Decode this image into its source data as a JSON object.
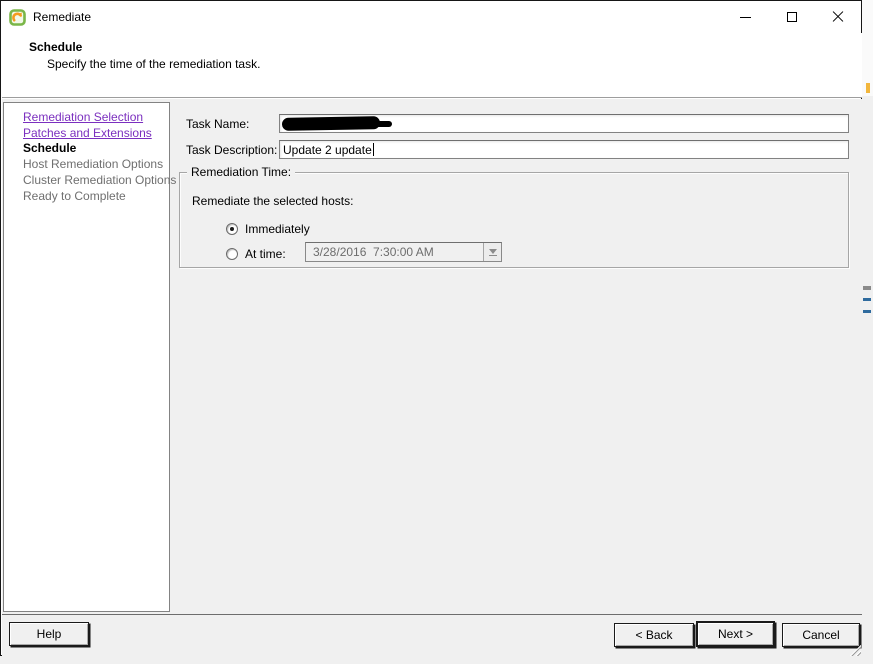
{
  "window": {
    "title": "Remediate",
    "controls": [
      "minimize",
      "maximize",
      "close"
    ]
  },
  "header": {
    "title": "Schedule",
    "subtitle": "Specify the time of the remediation task."
  },
  "sidebar": {
    "items": [
      {
        "label": "Remediation Selection",
        "state": "visited-link"
      },
      {
        "label": "Patches and Extensions",
        "state": "visited-link"
      },
      {
        "label": "Schedule",
        "state": "current"
      },
      {
        "label": "Host Remediation Options",
        "state": "upcoming"
      },
      {
        "label": "Cluster Remediation Options",
        "state": "upcoming"
      },
      {
        "label": "Ready to Complete",
        "state": "upcoming"
      }
    ]
  },
  "form": {
    "task_name": {
      "label": "Task Name:",
      "value": "",
      "redacted": true
    },
    "task_description": {
      "label": "Task Description:",
      "value": "Update 2 update"
    },
    "remediation_time": {
      "legend": "Remediation Time:",
      "prompt": "Remediate the selected hosts:",
      "options": [
        {
          "label": "Immediately",
          "selected": true
        },
        {
          "label": "At time:",
          "selected": false
        }
      ],
      "datetime": {
        "value": "3/28/2016  7:30:00 AM",
        "disabled": true
      }
    }
  },
  "footer": {
    "help_label": "Help",
    "back_label": "< Back",
    "next_label": "Next >",
    "cancel_label": "Cancel"
  },
  "colors": {
    "visited_link": "#7b2fbf",
    "current_step": "#000000",
    "upcoming_step": "#6f6f6f",
    "content_bg": "#f0f0f0",
    "window_bg": "#ffffff",
    "icon_green": "#7ab648",
    "icon_orange": "#f59b1f"
  }
}
